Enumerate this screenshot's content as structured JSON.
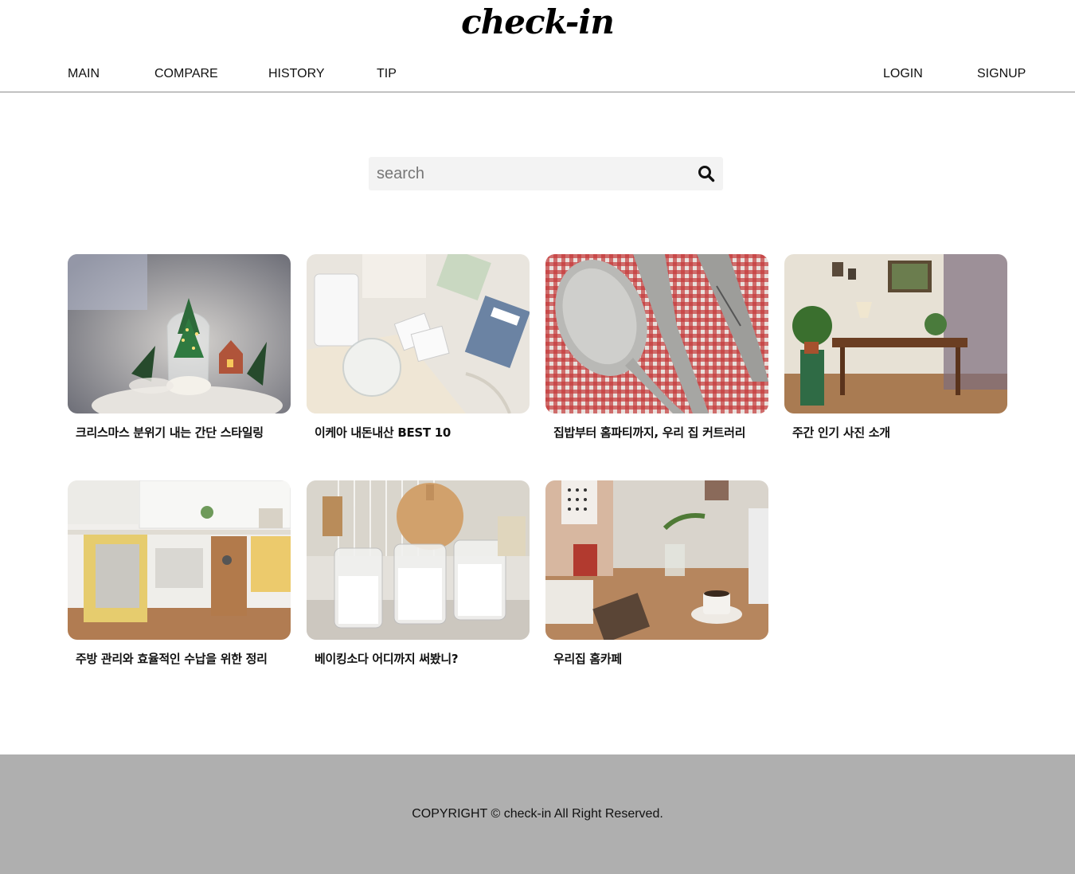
{
  "brand": {
    "logo": "check-in"
  },
  "nav": {
    "left": [
      "MAIN",
      "COMPARE",
      "HISTORY",
      "TIP"
    ],
    "right": [
      "LOGIN",
      "SIGNUP"
    ]
  },
  "search": {
    "placeholder": "search",
    "value": "",
    "icon": "search-icon"
  },
  "cards": [
    {
      "title": "크리스마스 분위기 내는 간단 스타일링",
      "image": "christmas-terrarium-photo"
    },
    {
      "title": "이케아 내돈내산 BEST 10",
      "image": "ikea-items-photo"
    },
    {
      "title": "집밥부터 홈파티까지, 우리 집 커트러리",
      "image": "cutlery-photo"
    },
    {
      "title": "주간 인기 사진 소개",
      "image": "dining-room-photo"
    },
    {
      "title": "주방 관리와 효율적인 수납을 위한 정리",
      "image": "kitchen-cabinet-photo"
    },
    {
      "title": "베이킹소다 어디까지 써봤니?",
      "image": "glass-jars-photo"
    },
    {
      "title": "우리집 홈카페",
      "image": "home-cafe-photo"
    }
  ],
  "footer": {
    "copyright": "COPYRIGHT © check-in All Right Reserved."
  },
  "colors": {
    "footer_bg": "#afafaf",
    "search_bg": "#f3f3f3",
    "nav_border": "#8c8c8c"
  }
}
